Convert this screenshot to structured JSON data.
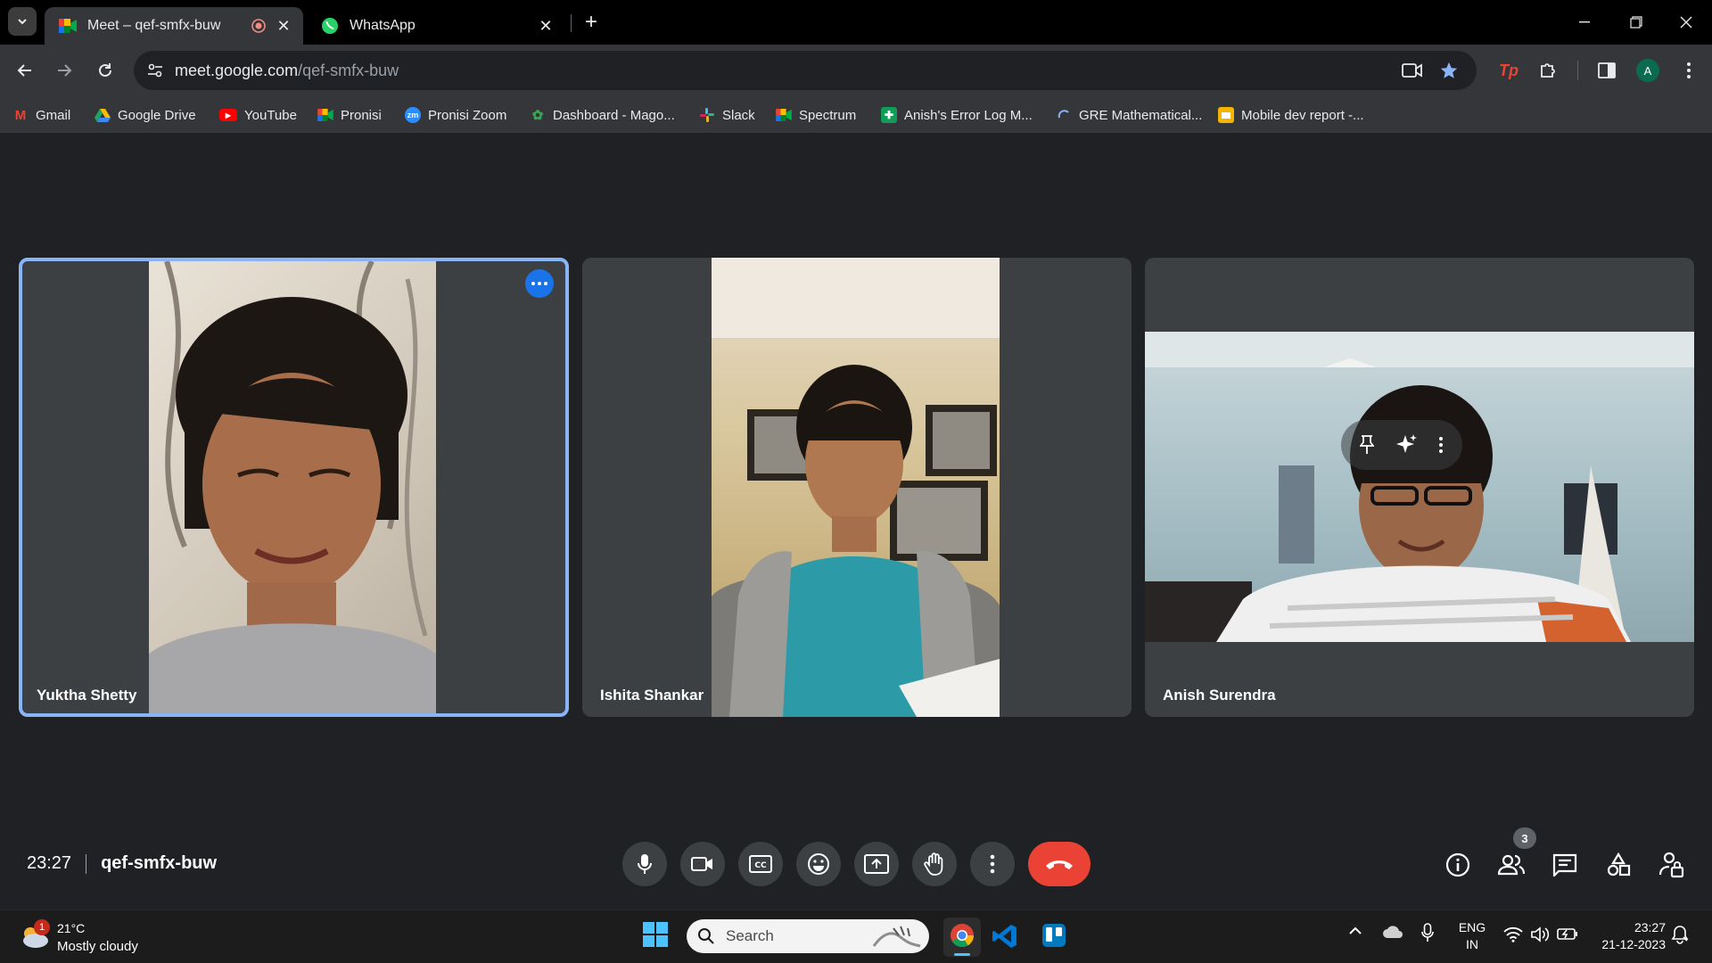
{
  "browser": {
    "tabs": [
      {
        "title": "Meet – qef-smfx-buw",
        "active": true
      },
      {
        "title": "WhatsApp",
        "active": false
      }
    ],
    "url": {
      "host": "meet.google.com",
      "path": "/qef-smfx-buw"
    },
    "bookmarks": [
      {
        "label": "Gmail",
        "icon": "gmail-icon"
      },
      {
        "label": "Google Drive",
        "icon": "drive-icon"
      },
      {
        "label": "YouTube",
        "icon": "youtube-icon"
      },
      {
        "label": "Pronisi",
        "icon": "meet-icon"
      },
      {
        "label": "Pronisi Zoom",
        "icon": "zoom-icon"
      },
      {
        "label": "Dashboard - Mago...",
        "icon": "dashboard-icon"
      },
      {
        "label": "Slack",
        "icon": "slack-icon"
      },
      {
        "label": "Spectrum",
        "icon": "meet-icon"
      },
      {
        "label": "Anish's Error Log M...",
        "icon": "sheets-icon"
      },
      {
        "label": "GRE Mathematical...",
        "icon": "loading-icon"
      },
      {
        "label": "Mobile dev report -...",
        "icon": "slides-icon"
      }
    ],
    "profile_initial": "A"
  },
  "meet": {
    "participants": [
      {
        "name": "Yuktha Shetty",
        "active_speaker": true
      },
      {
        "name": "Ishita Shankar",
        "active_speaker": false
      },
      {
        "name": "Anish Surendra",
        "active_speaker": false
      }
    ],
    "time": "23:27",
    "meeting_code": "qef-smfx-buw",
    "people_count": "3"
  },
  "taskbar": {
    "weather_badge": "1",
    "temperature": "21°C",
    "weather": "Mostly cloudy",
    "search_label": "Search",
    "lang_line1": "ENG",
    "lang_line2": "IN",
    "clock_time": "23:27",
    "clock_date": "21-12-2023"
  },
  "colors": {
    "meet_bg": "#202124",
    "tile_bg": "#3c4043",
    "active_outline": "#8ab4f8",
    "end_call": "#ea4335",
    "accent_blue": "#1a73e8"
  }
}
